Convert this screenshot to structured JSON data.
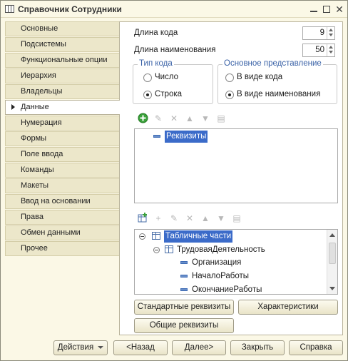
{
  "window": {
    "title": "Справочник Сотрудники",
    "controls": {
      "minimize": "—",
      "maximize": "□",
      "close": "✕"
    }
  },
  "sidebar": {
    "items": [
      {
        "label": "Основные"
      },
      {
        "label": "Подсистемы"
      },
      {
        "label": "Функциональные опции"
      },
      {
        "label": "Иерархия"
      },
      {
        "label": "Владельцы"
      },
      {
        "label": "Данные",
        "active": true
      },
      {
        "label": "Нумерация"
      },
      {
        "label": "Формы"
      },
      {
        "label": "Поле ввода"
      },
      {
        "label": "Команды"
      },
      {
        "label": "Макеты"
      },
      {
        "label": "Ввод на основании"
      },
      {
        "label": "Права"
      },
      {
        "label": "Обмен данными"
      },
      {
        "label": "Прочее"
      }
    ]
  },
  "data_tab": {
    "code_length": {
      "label": "Длина кода",
      "value": "9"
    },
    "name_length": {
      "label": "Длина наименования",
      "value": "50"
    },
    "code_type": {
      "title": "Тип кода",
      "options": [
        {
          "label": "Число",
          "selected": false
        },
        {
          "label": "Строка",
          "selected": true
        }
      ]
    },
    "main_presentation": {
      "title": "Основное представление",
      "options": [
        {
          "label": "В виде кода",
          "selected": false
        },
        {
          "label": "В виде наименования",
          "selected": true
        }
      ]
    },
    "attributes_tree": {
      "nodes": [
        {
          "label": "Реквизиты",
          "selected": true
        }
      ]
    },
    "tabular_tree": {
      "root": {
        "label": "Табличные части"
      },
      "child": {
        "label": "ТрудоваяДеятельность"
      },
      "fields": [
        {
          "label": "Организация"
        },
        {
          "label": "НачалоРаботы"
        },
        {
          "label": "ОкончаниеРаботы"
        }
      ]
    },
    "buttons": {
      "standard_attributes": "Стандартные реквизиты",
      "characteristics": "Характеристики",
      "common_attributes": "Общие реквизиты"
    }
  },
  "footer": {
    "actions": "Действия",
    "back": "<Назад",
    "next": "Далее>",
    "close": "Закрыть",
    "help": "Справка"
  }
}
